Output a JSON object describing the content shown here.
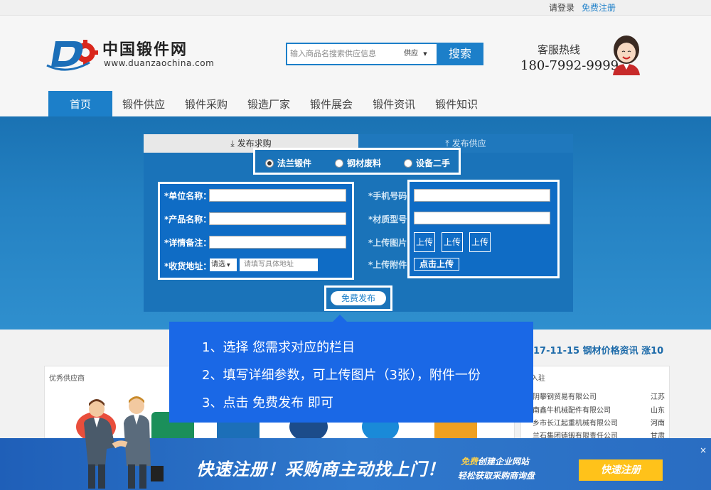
{
  "topbar": {
    "login": "请登录",
    "register": "免费注册"
  },
  "brand": {
    "name": "中国锻件网",
    "url": "www.duanzaochina.com"
  },
  "search": {
    "placeholder": "输入商品名搜索供应信息",
    "select": "供应",
    "button": "搜索"
  },
  "hotline": {
    "label": "客服热线",
    "number": "180-7992-9999"
  },
  "nav": [
    "首页",
    "锻件供应",
    "锻件采购",
    "锻造厂家",
    "锻件展会",
    "锻件资讯",
    "锻件知识"
  ],
  "form": {
    "tab_buy": "发布求购",
    "tab_sell": "发布供应",
    "radios": [
      "法兰锻件",
      "钢材废料",
      "设备二手"
    ],
    "left_fields": [
      "*单位名称：",
      "*产品名称：",
      "*详情备注：",
      "*收货地址："
    ],
    "region_select": "请选",
    "address_placeholder": "请填写具体地址",
    "right_labels": [
      "*手机号码：",
      "*材质型号：",
      "*上传图片：",
      "*上传附件："
    ],
    "upload": "上传",
    "attach": "点击上传",
    "publish": "免费发布"
  },
  "tips": [
    "1、选择 您需求对应的栏目",
    "2、填写详细参数，可上传图片（3张），附件一份",
    "3、点击 免费发布 即可"
  ],
  "news_line": "17-11-15 钢材价格资讯 涨10",
  "suppliers_title": "优秀供应商",
  "companies_title": "业入驻",
  "companies": [
    {
      "name": "阴攀钢贸易有限公司",
      "region": "江苏"
    },
    {
      "name": "南鑫牛机械配件有限公司",
      "region": "山东"
    },
    {
      "name": "乡市长江起重机械有限公司",
      "region": "河南"
    },
    {
      "name": "兰石集团铸锻有限责任公司",
      "region": "甘肃"
    }
  ],
  "bottom": {
    "main": "快速注册！采购商主动找上门！",
    "sub1_free": "免费",
    "sub1_rest": "创建企业网站",
    "sub2": "轻松获取采购商询盘",
    "button": "快速注册",
    "close": "×"
  },
  "colors": {
    "brand_blue": "#1c7fc9",
    "tip_blue": "#1a68e6",
    "cta_yellow": "#ffc21a"
  }
}
